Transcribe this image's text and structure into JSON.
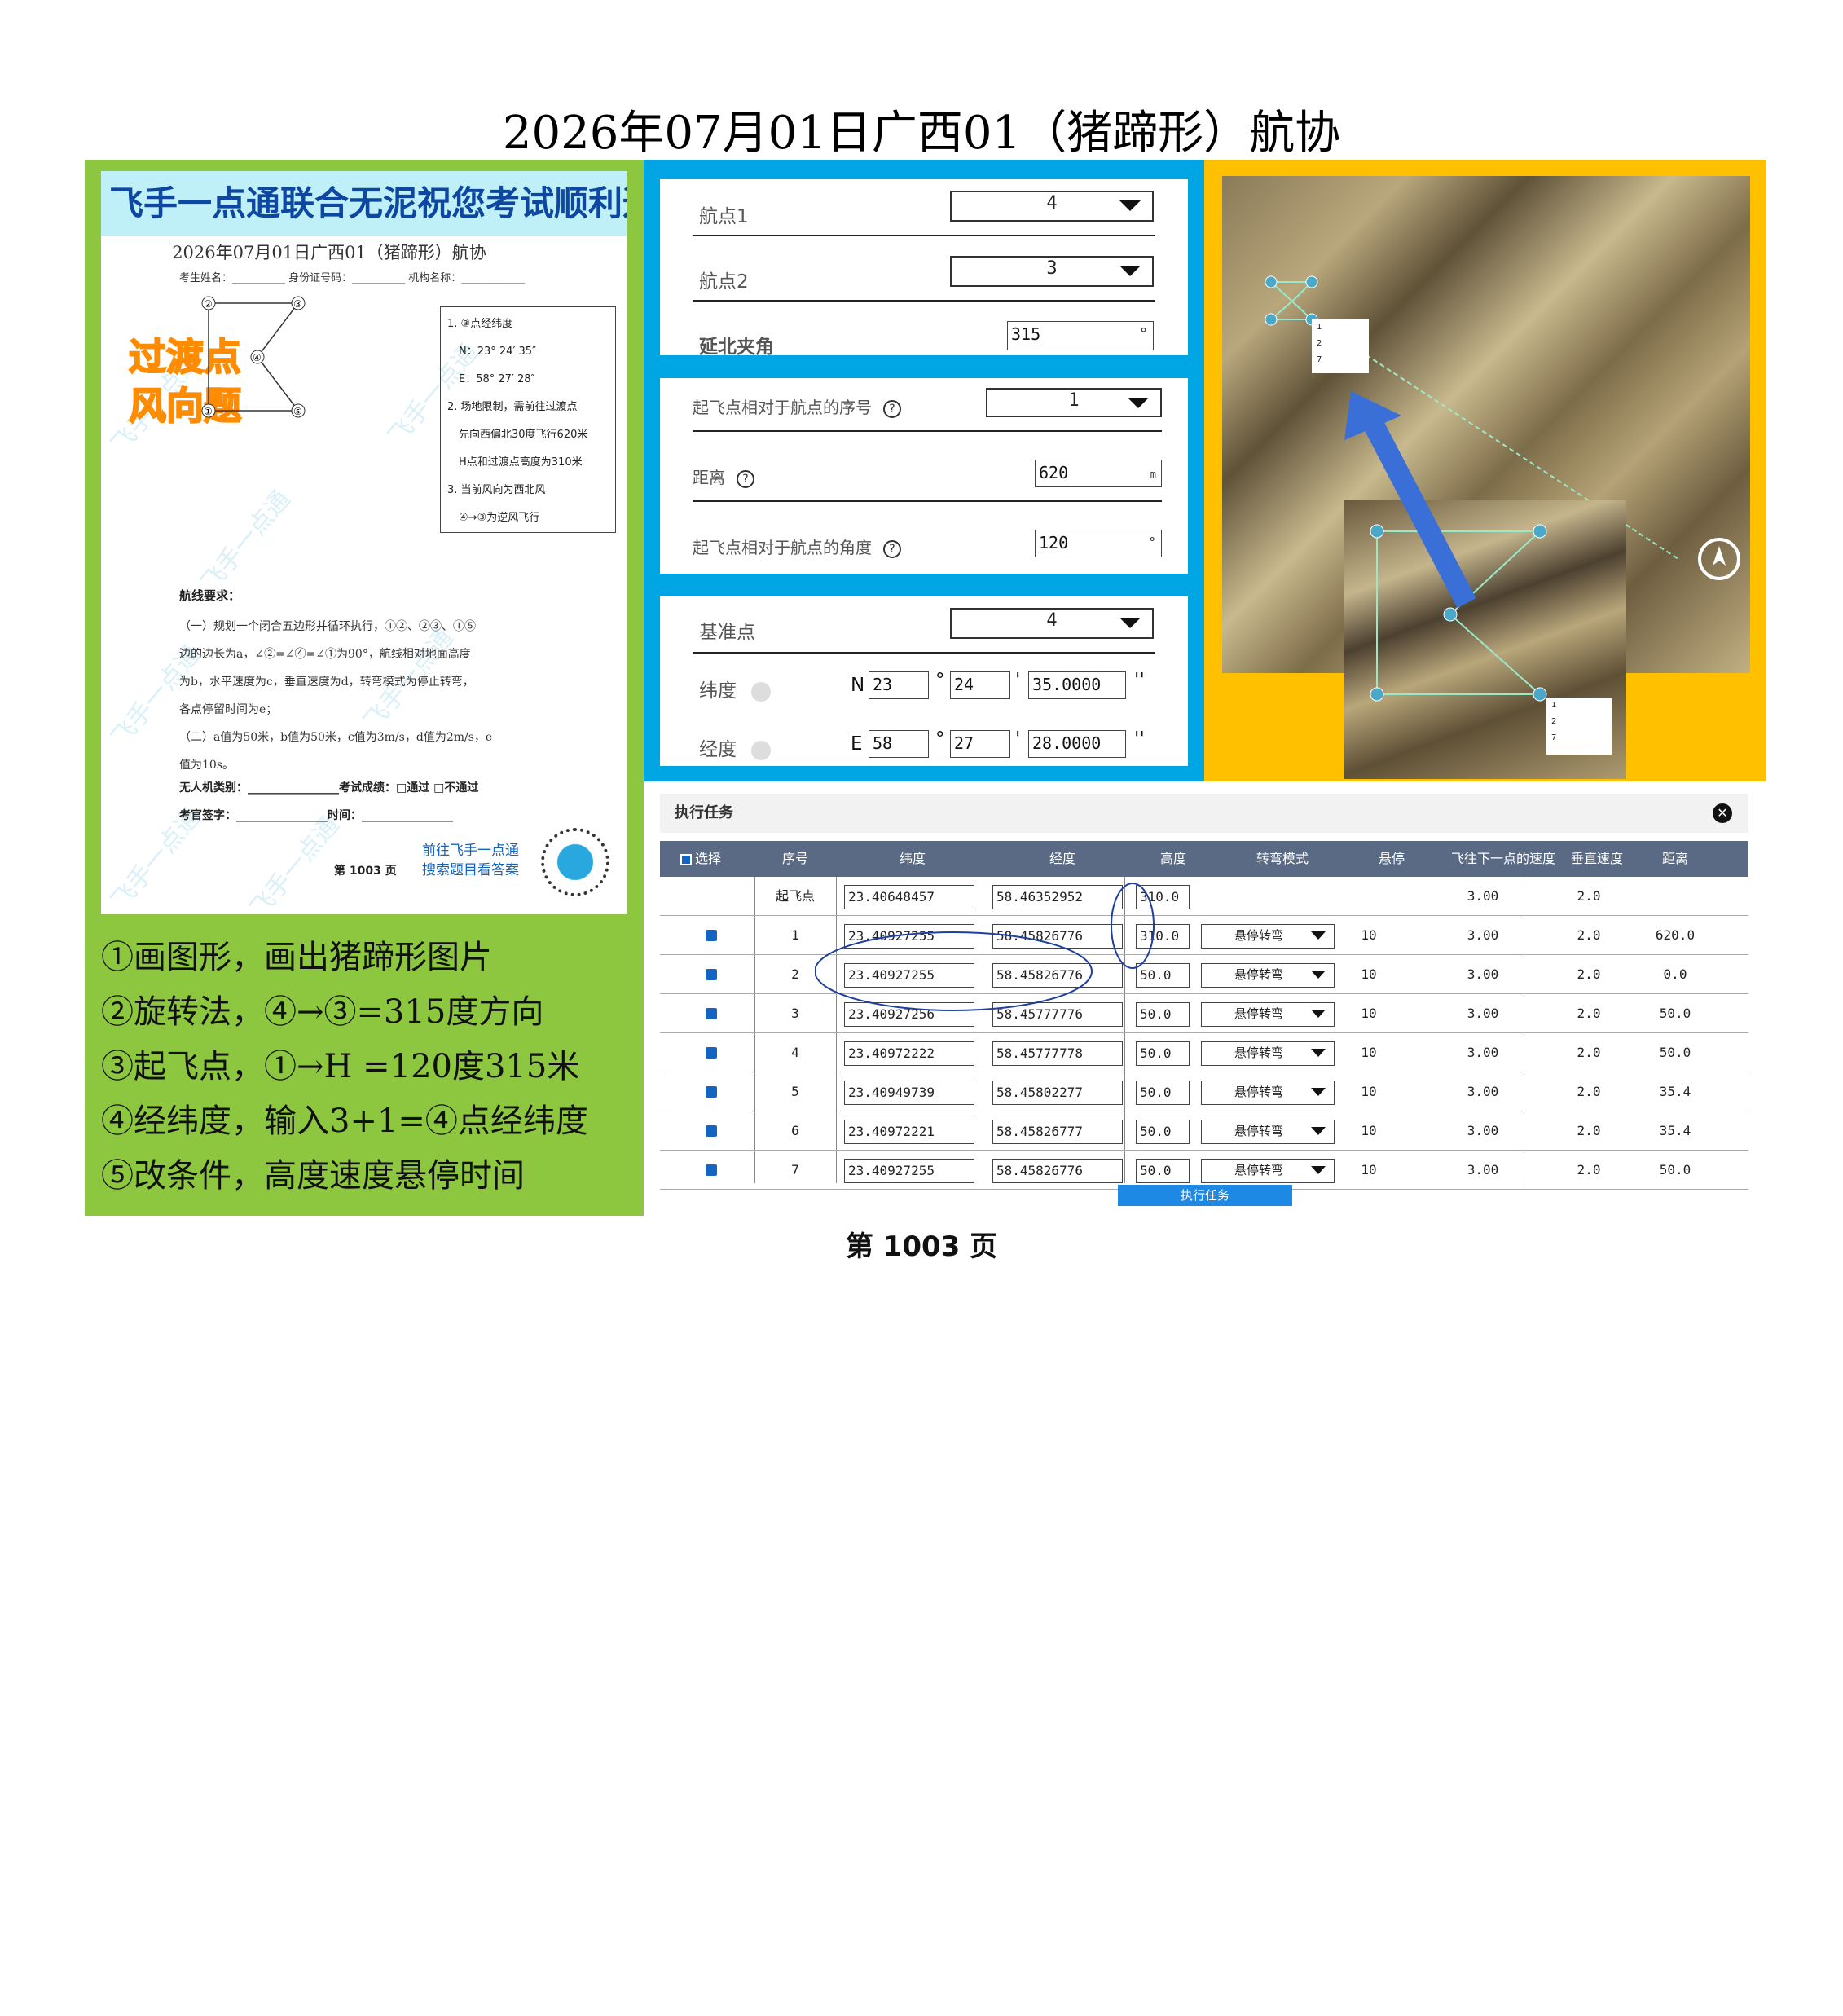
{
  "page_title": "2026年07月01日广西01（猪蹄形）航协",
  "doc": {
    "banner": "飞手一点通联合无泥祝您考试顺利通过",
    "subtitle": "2026年07月01日广西01（猪蹄形）航协",
    "info_line": "考生姓名：__________ 身份证号码：__________ 机构名称：____________",
    "stamp1": "过渡点",
    "stamp2": "风向题",
    "diagram_points": [
      "②",
      "③",
      "④",
      "①",
      "⑤"
    ],
    "notes": [
      "1. ③点经纬度",
      "N：23° 24′ 35″",
      "E：58° 27′ 28″",
      "2. 场地限制，需前往过渡点",
      "先向西偏北30度飞行620米",
      "H点和过渡点高度为310米",
      "3. 当前风向为西北风",
      "④→③为逆风飞行"
    ],
    "route_title": "航线要求：",
    "route_lines": [
      "（一）规划一个闭合五边形并循环执行，①②、②③、①⑤",
      "边的边长为a，∠②=∠④=∠①为90°，航线相对地面高度",
      "为b，水平速度为c，垂直速度为d，转弯模式为停止转弯，",
      "各点停留时间为e；",
      "（二）a值为50米，b值为50米，c值为3m/s，d值为2m/s，e",
      "值为10s。"
    ],
    "uav_line": "无人机类别：________________考试成绩：□通过  □不通过",
    "examiner_line": "考官签字：________________时间：________________",
    "page_no": "第 1003 页",
    "qr_text1": "前往飞手一点通",
    "qr_text2": "搜索题目看答案",
    "watermark": "飞手一点通"
  },
  "steps": [
    "①画图形，画出猪蹄形图片",
    "②旋转法，④→③=315度方向",
    "③起飞点，①→H =120度315米",
    "④经纬度，输入3+1=④点经纬度",
    "⑤改条件，高度速度悬停时间"
  ],
  "form": {
    "wp1_label": "航点1",
    "wp1_value": "4",
    "wp2_label": "航点2",
    "wp2_value": "3",
    "angle_label": "延北夹角",
    "angle_value": "315",
    "deg": "°",
    "takeoff_seq_label": "起飞点相对于航点的序号",
    "takeoff_seq_value": "1",
    "distance_label": "距离",
    "distance_value": "620",
    "distance_unit": "m",
    "takeoff_angle_label": "起飞点相对于航点的角度",
    "takeoff_angle_value": "120",
    "base_label": "基准点",
    "base_value": "4",
    "lat_label": "纬度",
    "lat_prefix": "N",
    "lat_d": "23",
    "lat_m": "24",
    "lat_s": "35.0000",
    "lon_label": "经度",
    "lon_prefix": "E",
    "lon_d": "58",
    "lon_m": "27",
    "lon_s": "28.0000",
    "min_mark": "'",
    "sec_mark": "''"
  },
  "task": {
    "title": "执行任务",
    "close": "✕",
    "headers": [
      "选择",
      "序号",
      "纬度",
      "经度",
      "高度",
      "转弯模式",
      "悬停",
      "飞往下一点的速度",
      "垂直速度",
      "距离"
    ],
    "rows": [
      {
        "seq": "起飞点",
        "lat": "23.40648457",
        "lon": "58.46352952",
        "alt": "310.0",
        "turn": "",
        "hover": "",
        "speed": "3.00",
        "vspeed": "2.0",
        "dist": ""
      },
      {
        "seq": "1",
        "lat": "23.40927255",
        "lon": "58.45826776",
        "alt": "310.0",
        "turn": "悬停转弯",
        "hover": "10",
        "speed": "3.00",
        "vspeed": "2.0",
        "dist": "620.0"
      },
      {
        "seq": "2",
        "lat": "23.40927255",
        "lon": "58.45826776",
        "alt": "50.0",
        "turn": "悬停转弯",
        "hover": "10",
        "speed": "3.00",
        "vspeed": "2.0",
        "dist": "0.0"
      },
      {
        "seq": "3",
        "lat": "23.40927256",
        "lon": "58.45777776",
        "alt": "50.0",
        "turn": "悬停转弯",
        "hover": "10",
        "speed": "3.00",
        "vspeed": "2.0",
        "dist": "50.0"
      },
      {
        "seq": "4",
        "lat": "23.40972222",
        "lon": "58.45777778",
        "alt": "50.0",
        "turn": "悬停转弯",
        "hover": "10",
        "speed": "3.00",
        "vspeed": "2.0",
        "dist": "50.0"
      },
      {
        "seq": "5",
        "lat": "23.40949739",
        "lon": "58.45802277",
        "alt": "50.0",
        "turn": "悬停转弯",
        "hover": "10",
        "speed": "3.00",
        "vspeed": "2.0",
        "dist": "35.4"
      },
      {
        "seq": "6",
        "lat": "23.40972221",
        "lon": "58.45826777",
        "alt": "50.0",
        "turn": "悬停转弯",
        "hover": "10",
        "speed": "3.00",
        "vspeed": "2.0",
        "dist": "35.4"
      },
      {
        "seq": "7",
        "lat": "23.40927255",
        "lon": "58.45826776",
        "alt": "50.0",
        "turn": "悬停转弯",
        "hover": "10",
        "speed": "3.00",
        "vspeed": "2.0",
        "dist": "50.0"
      }
    ],
    "execute_button": "执行任务"
  },
  "map": {
    "menu_items": [
      "1",
      "2",
      "7"
    ],
    "inset_menu_items": [
      "1",
      "2",
      "7"
    ]
  },
  "footer": "第 1003 页",
  "colors": {
    "green": "#8dc63f",
    "cyan": "#00a6e4",
    "yellow": "#ffc000",
    "table_header": "#5a6a85",
    "arrow": "#3b6fd8"
  }
}
